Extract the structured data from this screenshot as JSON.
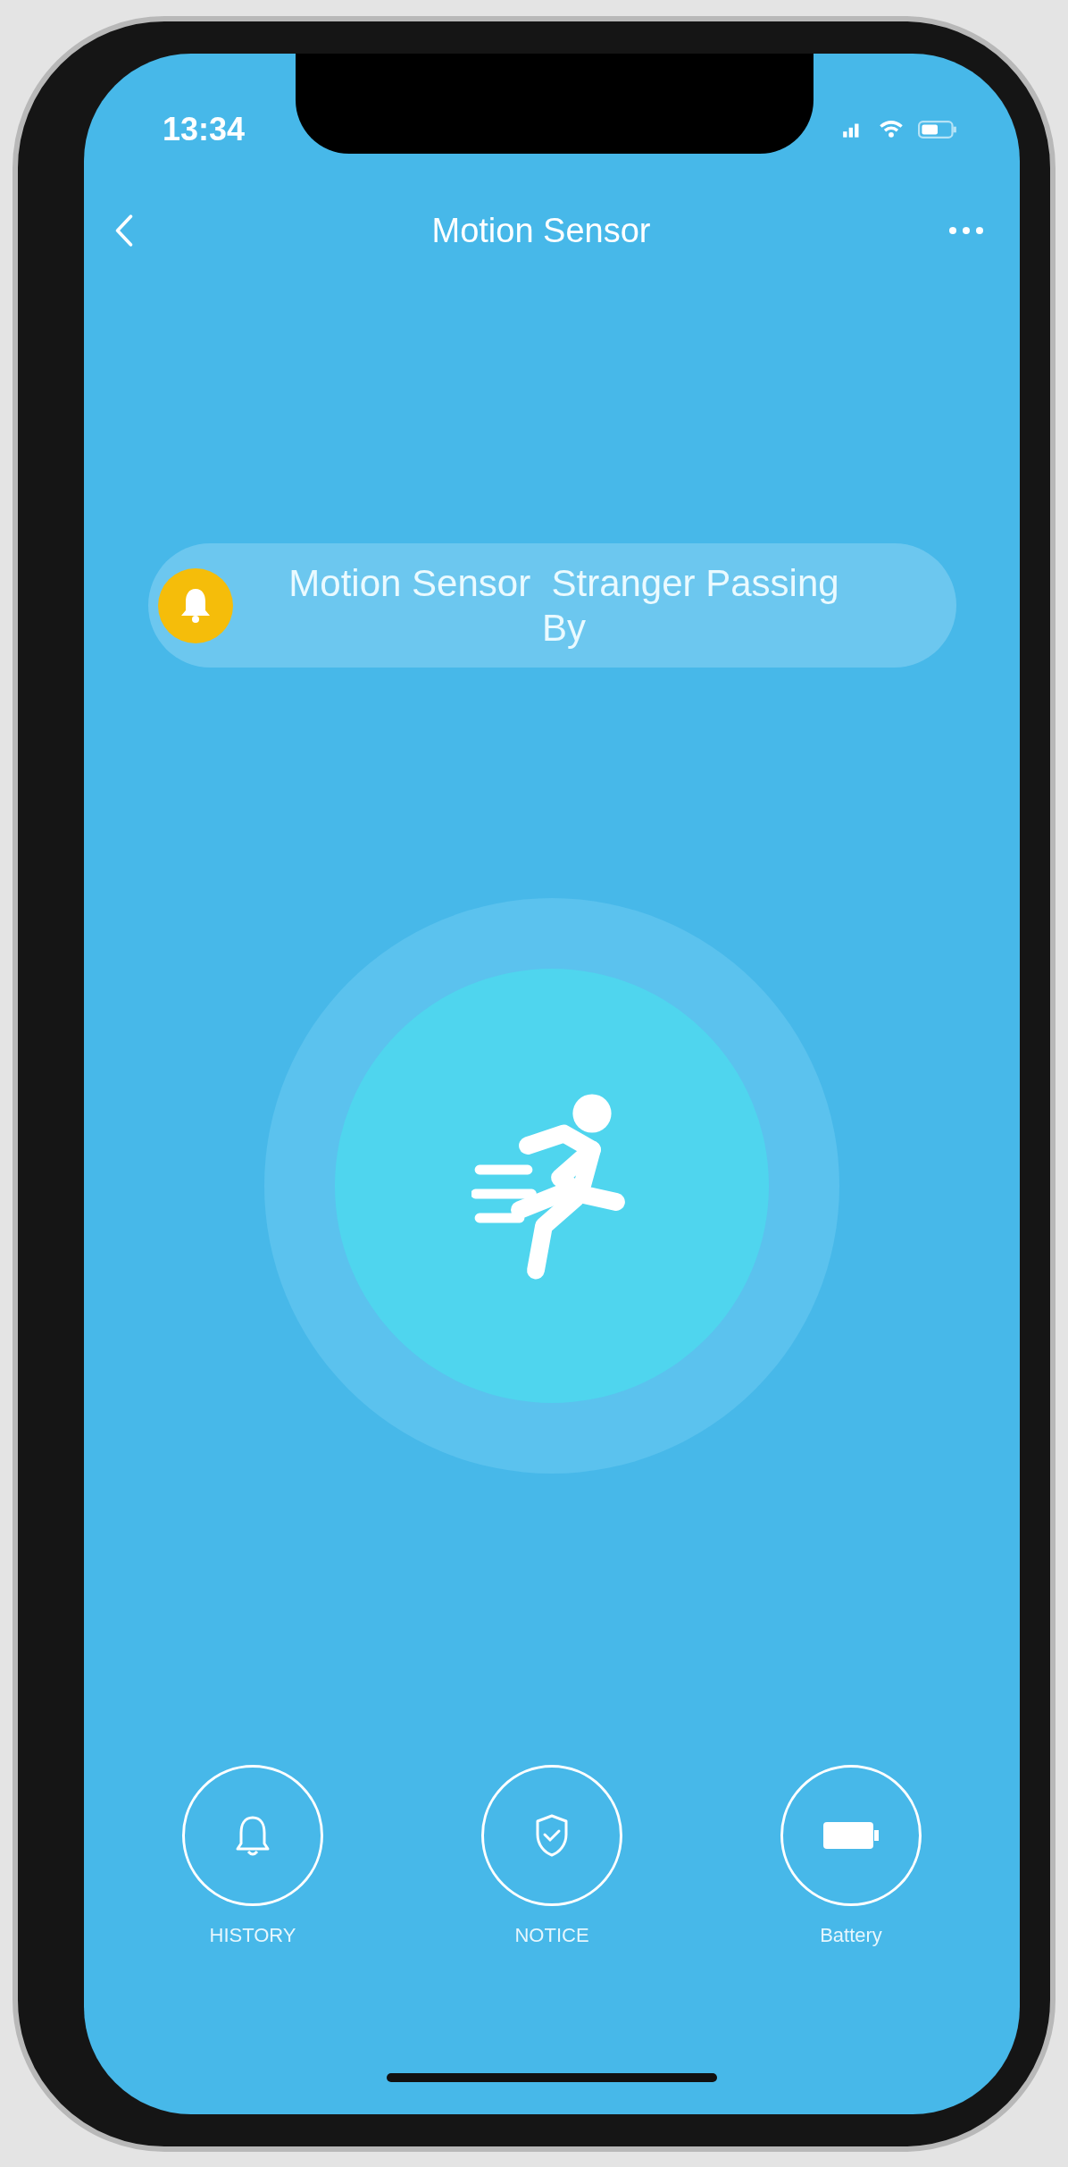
{
  "status_bar": {
    "time": "13:34"
  },
  "nav": {
    "title": "Motion Sensor"
  },
  "alert": {
    "text": "Motion Sensor  Stranger Passing By"
  },
  "actions": [
    {
      "label": "HISTORY",
      "kind": "bell"
    },
    {
      "label": "NOTICE",
      "kind": "shield"
    },
    {
      "label": "Battery",
      "kind": "battery"
    }
  ]
}
